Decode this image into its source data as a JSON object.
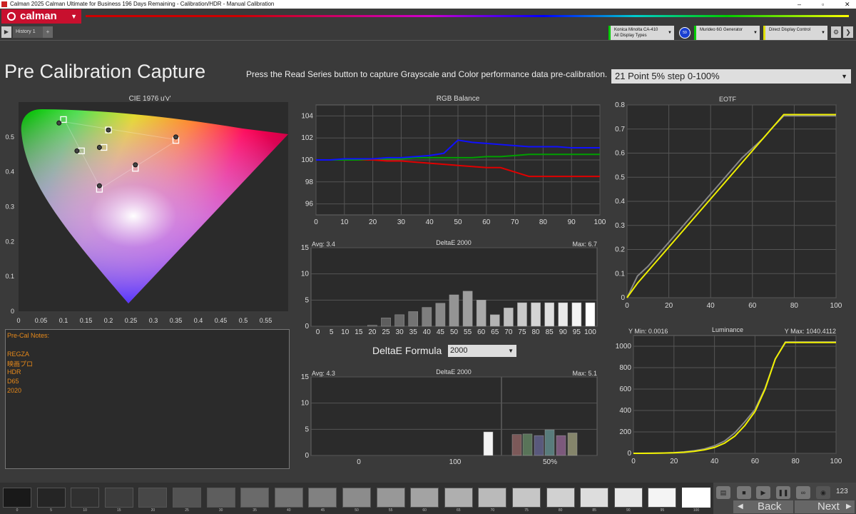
{
  "window": {
    "title": "Calman 2025 Calman Ultimate for Business 196 Days Remaining  - Calibration/HDR - Manual Calibration",
    "minimize": "–",
    "maximize": "▫",
    "close": "✕"
  },
  "menubar": {
    "logo_text": "calman",
    "logo_arrow": "▼"
  },
  "tabs": [
    {
      "label": "History 1"
    }
  ],
  "tabbar": {
    "nav_arrow": "▶",
    "add_tab": "+"
  },
  "devices": [
    {
      "line1": "Konica Minolta CA-410",
      "line2": "All Display Types",
      "badge": "59",
      "accent": "#00c000"
    },
    {
      "line1": "Murideo 6G Generator",
      "line2": "",
      "accent": "#00c000"
    },
    {
      "line1": "Direct Display Control",
      "line2": "",
      "accent": "#e0e000"
    }
  ],
  "page": {
    "title": "Pre Calibration Capture",
    "instruction": "Press the Read Series button to capture Grayscale and Color performance data pre-calibration.",
    "series_select": "21 Point 5% step 0-100%"
  },
  "cie": {
    "title": "CIE 1976 u'v'",
    "x_ticks": [
      "0",
      "0.05",
      "0.1",
      "0.15",
      "0.2",
      "0.25",
      "0.3",
      "0.35",
      "0.4",
      "0.45",
      "0.5",
      "0.55"
    ],
    "y_ticks": [
      "0",
      "0.1",
      "0.2",
      "0.3",
      "0.4",
      "0.5"
    ]
  },
  "rgb_balance": {
    "title": "RGB Balance",
    "x_ticks": [
      "0",
      "10",
      "20",
      "30",
      "40",
      "50",
      "60",
      "70",
      "80",
      "90",
      "100"
    ],
    "y_ticks": [
      "96",
      "98",
      "100",
      "102",
      "104"
    ]
  },
  "deltae_gray": {
    "title": "DeltaE 2000",
    "avg": "Avg: 3.4",
    "max": "Max: 6.7",
    "y_ticks": [
      "0",
      "5",
      "10",
      "15"
    ],
    "x_labels": [
      "0",
      "5",
      "10",
      "15",
      "20",
      "25",
      "30",
      "35",
      "40",
      "45",
      "50",
      "55",
      "60",
      "65",
      "70",
      "75",
      "80",
      "85",
      "90",
      "95",
      "100"
    ]
  },
  "deltae_formula": {
    "label": "DeltaE Formula",
    "value": "2000",
    "arrow": "▼"
  },
  "deltae_color": {
    "title": "DeltaE 2000",
    "avg": "Avg: 4.3",
    "max": "Max: 5.1",
    "y_ticks": [
      "0",
      "5",
      "10",
      "15"
    ],
    "x_labels": [
      "0",
      "100",
      "50%"
    ]
  },
  "eotf": {
    "title": "EOTF",
    "x_ticks": [
      "0",
      "20",
      "40",
      "60",
      "80",
      "100"
    ],
    "y_ticks": [
      "0",
      "0.1",
      "0.2",
      "0.3",
      "0.4",
      "0.5",
      "0.6",
      "0.7",
      "0.8"
    ]
  },
  "luminance": {
    "title": "Luminance",
    "ymin": "Y Min: 0.0016",
    "ymax": "Y Max: 1040.4112",
    "x_ticks": [
      "0",
      "20",
      "40",
      "60",
      "80",
      "100"
    ],
    "y_ticks": [
      "0",
      "200",
      "400",
      "600",
      "800",
      "1000"
    ]
  },
  "notes": {
    "header": "Pre-Cal Notes:",
    "lines": [
      "REGZA",
      "映画プロ",
      "HDR",
      "D65",
      "2020"
    ]
  },
  "swatches": [
    "0",
    "5",
    "10",
    "15",
    "20",
    "25",
    "30",
    "35",
    "40",
    "45",
    "50",
    "55",
    "60",
    "65",
    "70",
    "75",
    "80",
    "85",
    "90",
    "95",
    "100"
  ],
  "controls": {
    "back": "Back",
    "next": "Next",
    "counter": "123",
    "back_arrow": "◀",
    "next_arrow": "▶"
  },
  "chart_data": [
    {
      "type": "scatter",
      "title": "CIE 1976 u'v'",
      "xlim": [
        0,
        0.6
      ],
      "ylim": [
        0,
        0.6
      ],
      "series": [
        {
          "name": "target",
          "points": [
            [
              0.1,
              0.55
            ],
            [
              0.14,
              0.46
            ],
            [
              0.19,
              0.47
            ],
            [
              0.2,
              0.52
            ],
            [
              0.26,
              0.41
            ],
            [
              0.35,
              0.49
            ],
            [
              0.18,
              0.35
            ]
          ]
        },
        {
          "name": "measured",
          "points": [
            [
              0.09,
              0.54
            ],
            [
              0.13,
              0.46
            ],
            [
              0.18,
              0.47
            ],
            [
              0.2,
              0.52
            ],
            [
              0.26,
              0.42
            ],
            [
              0.35,
              0.5
            ],
            [
              0.18,
              0.36
            ]
          ]
        }
      ]
    },
    {
      "type": "line",
      "title": "RGB Balance",
      "x": [
        0,
        5,
        10,
        15,
        20,
        25,
        30,
        35,
        40,
        45,
        50,
        55,
        60,
        65,
        70,
        75,
        80,
        85,
        90,
        95,
        100
      ],
      "xlim": [
        0,
        100
      ],
      "ylim": [
        95,
        105
      ],
      "series": [
        {
          "color": "#e00000",
          "values": [
            100,
            100,
            100,
            100,
            100,
            99.9,
            99.9,
            99.8,
            99.7,
            99.6,
            99.5,
            99.4,
            99.3,
            99.3,
            98.9,
            98.5,
            98.5,
            98.5,
            98.5,
            98.5,
            98.5
          ]
        },
        {
          "color": "#00a000",
          "values": [
            100,
            100,
            100,
            100,
            100.1,
            100.1,
            100.1,
            100.2,
            100.2,
            100.2,
            100.2,
            100.2,
            100.3,
            100.3,
            100.4,
            100.5,
            100.5,
            100.5,
            100.5,
            100.5,
            100.5
          ]
        },
        {
          "color": "#1010ff",
          "values": [
            100,
            100,
            100.1,
            100.1,
            100.1,
            100.2,
            100.2,
            100.3,
            100.4,
            100.6,
            101.8,
            101.6,
            101.5,
            101.4,
            101.3,
            101.2,
            101.2,
            101.2,
            101.1,
            101.1,
            101.1
          ]
        }
      ]
    },
    {
      "type": "bar",
      "title": "DeltaE 2000",
      "categories": [
        "0",
        "5",
        "10",
        "15",
        "20",
        "25",
        "30",
        "35",
        "40",
        "45",
        "50",
        "55",
        "60",
        "65",
        "70",
        "75",
        "80",
        "85",
        "90",
        "95",
        "100"
      ],
      "values": [
        0,
        0,
        0,
        0,
        0.2,
        1.6,
        2.2,
        2.8,
        3.6,
        4.4,
        6.0,
        6.7,
        5.0,
        2.2,
        3.5,
        4.5,
        4.5,
        4.5,
        4.5,
        4.5,
        4.5
      ],
      "ylim": [
        0,
        15
      ]
    },
    {
      "type": "bar",
      "title": "DeltaE 2000",
      "values": [
        4.5,
        4.0,
        4.1,
        3.8,
        4.9,
        3.8,
        4.3
      ],
      "colors": [
        "#ffffff",
        "#c08080",
        "#80b080",
        "#8080c0",
        "#80c0c0",
        "#c080c0",
        "#d0d0a0"
      ],
      "ylim": [
        0,
        15
      ]
    },
    {
      "type": "line",
      "title": "EOTF",
      "x": [
        0,
        5,
        10,
        15,
        20,
        25,
        30,
        35,
        40,
        45,
        50,
        55,
        60,
        65,
        70,
        75,
        80,
        85,
        90,
        95,
        100
      ],
      "xlim": [
        0,
        100
      ],
      "ylim": [
        0,
        0.8
      ],
      "series": [
        {
          "color": "#888888",
          "values": [
            0.0,
            0.09,
            0.13,
            0.18,
            0.23,
            0.28,
            0.33,
            0.38,
            0.43,
            0.48,
            0.53,
            0.58,
            0.62,
            0.66,
            0.71,
            0.755,
            0.755,
            0.755,
            0.755,
            0.755,
            0.755
          ]
        },
        {
          "color": "#f0f000",
          "values": [
            0.0,
            0.06,
            0.11,
            0.16,
            0.21,
            0.26,
            0.31,
            0.36,
            0.41,
            0.46,
            0.51,
            0.56,
            0.61,
            0.66,
            0.71,
            0.76,
            0.76,
            0.76,
            0.76,
            0.76,
            0.76
          ]
        }
      ]
    },
    {
      "type": "line",
      "title": "Luminance",
      "x": [
        0,
        5,
        10,
        15,
        20,
        25,
        30,
        35,
        40,
        45,
        50,
        55,
        60,
        65,
        70,
        75,
        80,
        85,
        90,
        95,
        100
      ],
      "xlim": [
        0,
        100
      ],
      "ylim": [
        0,
        1100
      ],
      "series": [
        {
          "color": "#888888",
          "values": [
            0,
            0.5,
            1.5,
            3.5,
            7,
            13,
            24,
            41,
            70,
            115,
            190,
            295,
            410,
            610,
            880,
            1040,
            1040,
            1040,
            1040,
            1040,
            1040
          ]
        },
        {
          "color": "#f0f000",
          "values": [
            0,
            0.3,
            1,
            2.5,
            5,
            10,
            18,
            32,
            55,
            95,
            160,
            260,
            390,
            600,
            880,
            1035,
            1035,
            1035,
            1035,
            1035,
            1035
          ]
        }
      ]
    }
  ]
}
